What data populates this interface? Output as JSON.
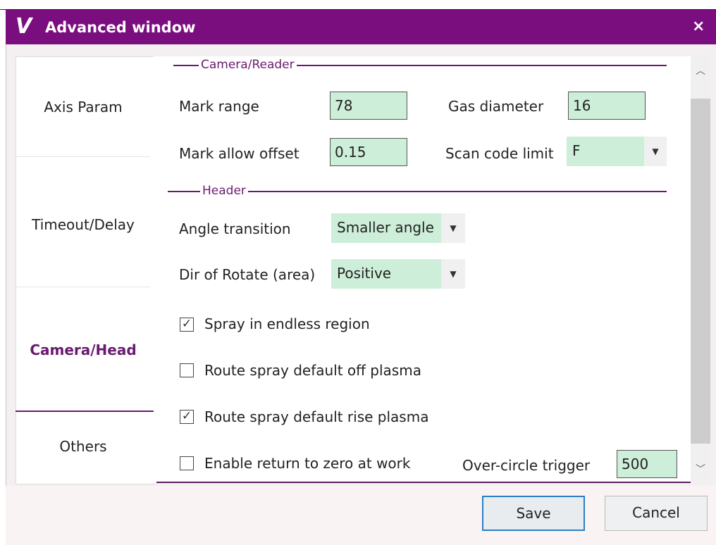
{
  "window": {
    "logo": "V",
    "title": "Advanced window",
    "close_icon": "×"
  },
  "sidebar": {
    "tabs": [
      {
        "label": "Axis Param",
        "active": false
      },
      {
        "label": "Timeout/Delay",
        "active": false
      },
      {
        "label": "Camera/Head",
        "active": true
      },
      {
        "label": "Others",
        "active": false
      }
    ]
  },
  "camera_reader": {
    "group_label": "Camera/Reader",
    "mark_range_label": "Mark range",
    "mark_range_value": "78",
    "gas_diameter_label": "Gas diameter",
    "gas_diameter_value": "16",
    "mark_allow_offset_label": "Mark allow offset",
    "mark_allow_offset_value": "0.15",
    "scan_code_limit_label": "Scan code limit",
    "scan_code_limit_value": "F"
  },
  "header": {
    "group_label": "Header",
    "angle_transition_label": "Angle transition",
    "angle_transition_value": "Smaller angle",
    "dir_rotate_label": "Dir of Rotate (area)",
    "dir_rotate_value": "Positive",
    "spray_endless_label": "Spray in endless region",
    "spray_endless_checked": true,
    "route_off_label": "Route spray default off plasma",
    "route_off_checked": false,
    "route_rise_label": "Route spray default rise plasma",
    "route_rise_checked": true,
    "return_zero_label": "Enable return to zero at work",
    "return_zero_checked": false,
    "over_circle_label": "Over-circle trigger",
    "over_circle_value": "500"
  },
  "buttons": {
    "save": "Save",
    "cancel": "Cancel"
  },
  "colors": {
    "accent": "#7a0e7f",
    "field_bg": "#cdeed8",
    "save_border": "#2a7fc6"
  },
  "icons": {
    "scroll_up": "up-arrow-icon",
    "scroll_down": "down-arrow-icon",
    "dropdown": "caret-down-icon",
    "check": "checkmark-icon"
  }
}
